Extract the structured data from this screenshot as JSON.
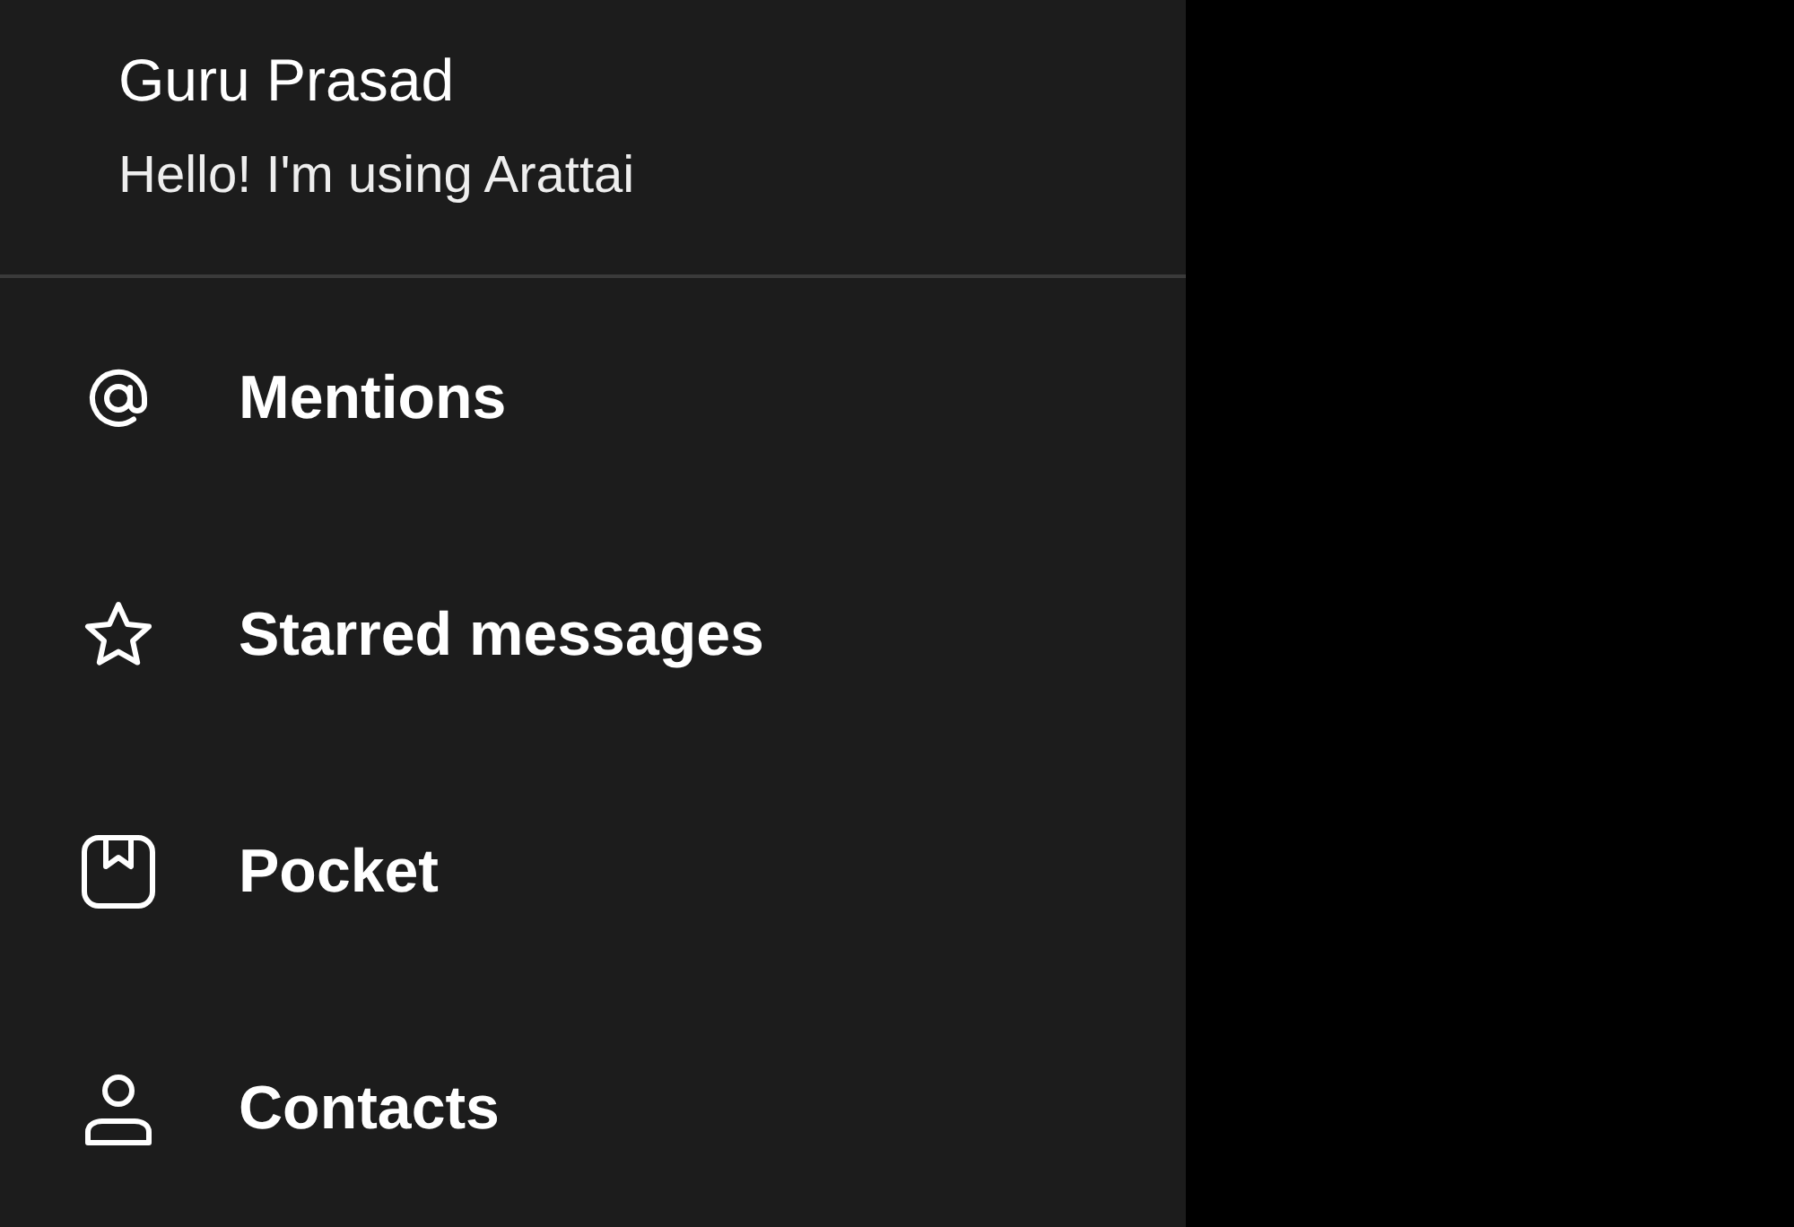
{
  "profile": {
    "name": "Guru Prasad",
    "status": "Hello! I'm using Arattai"
  },
  "menu": [
    {
      "kind": "mention",
      "label": "Mentions"
    },
    {
      "kind": "star",
      "label": "Starred messages"
    },
    {
      "kind": "pocket",
      "label": "Pocket"
    },
    {
      "kind": "contact",
      "label": "Contacts"
    }
  ]
}
